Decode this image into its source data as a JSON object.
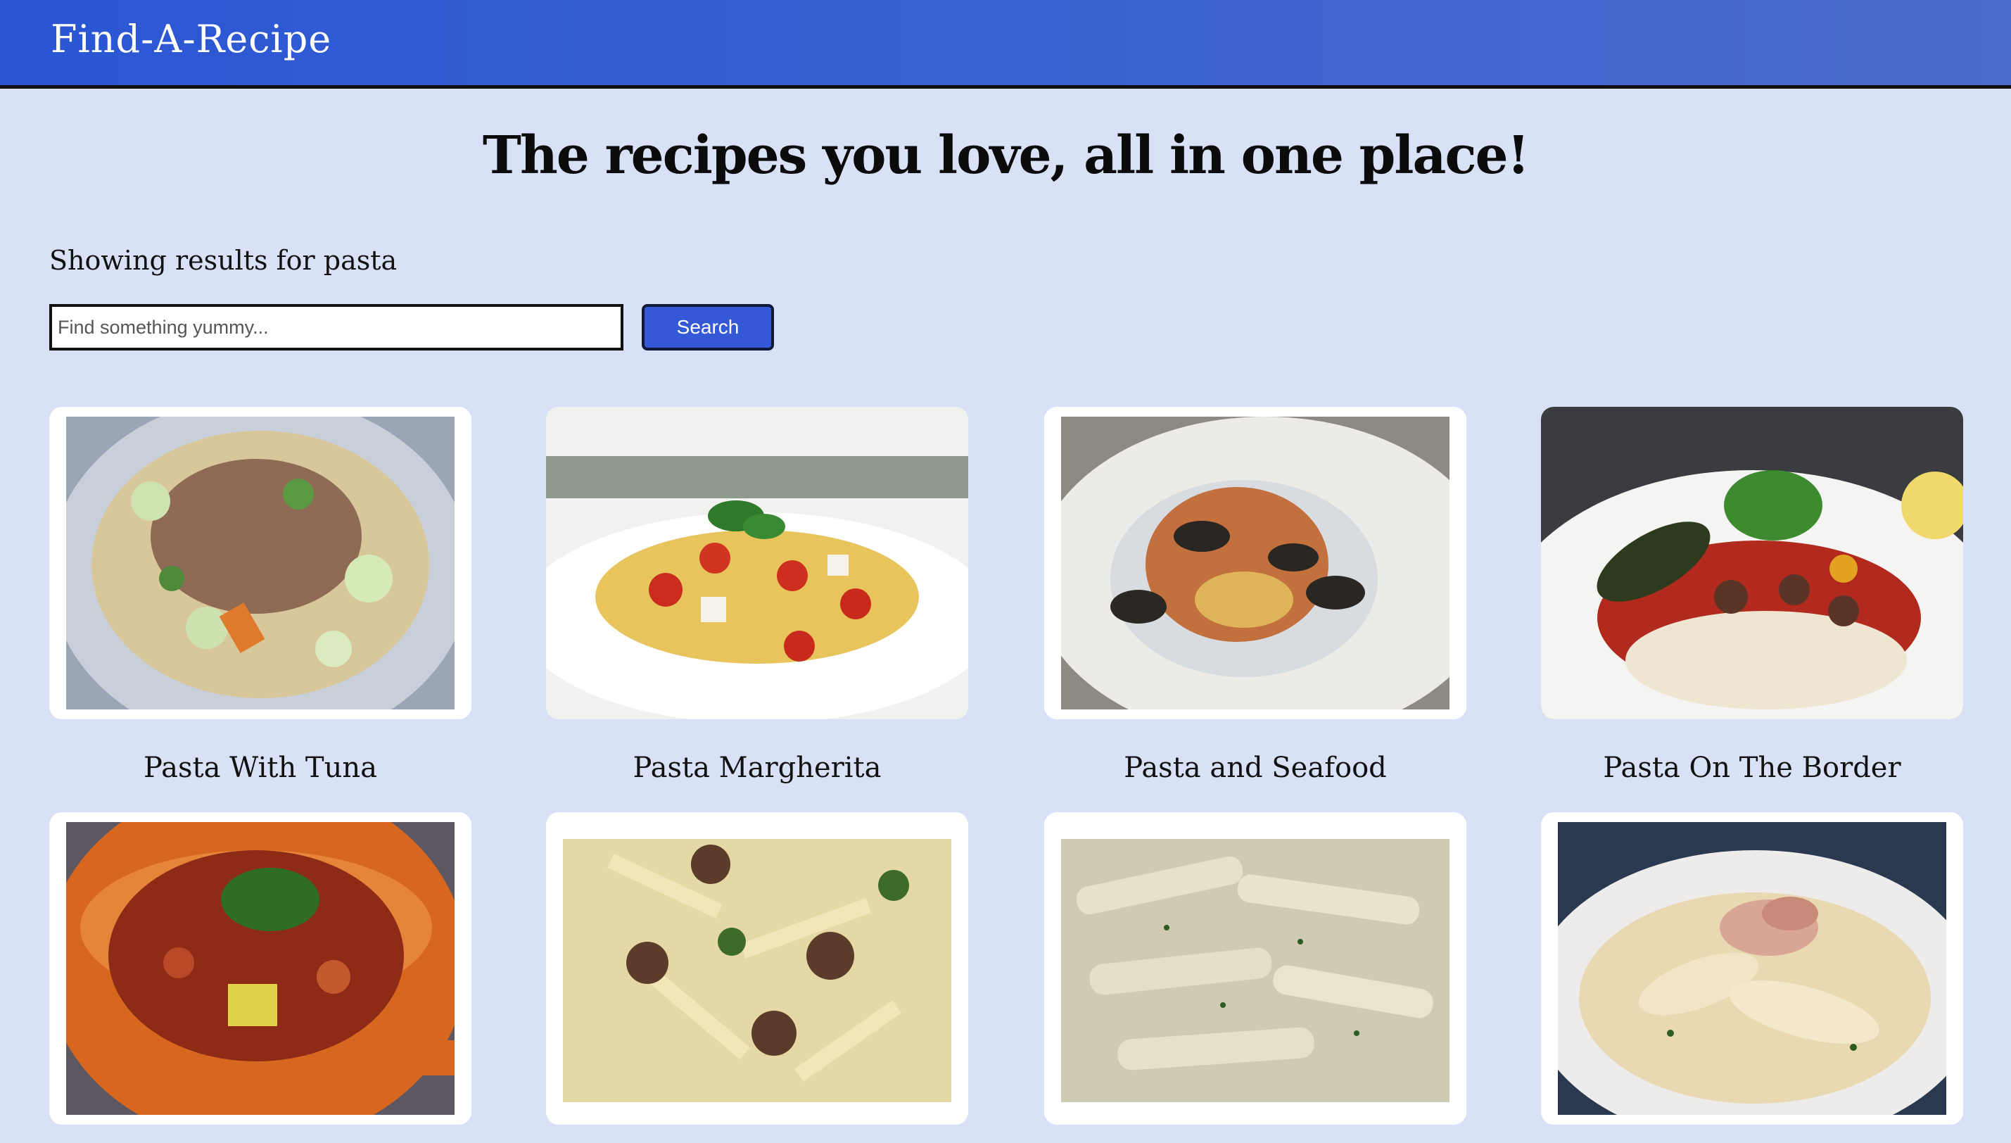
{
  "header": {
    "brand": "Find-A-Recipe"
  },
  "hero": {
    "title": "The recipes you love, all in one place!"
  },
  "search": {
    "results_prefix": "Showing results for ",
    "query": "pasta",
    "placeholder": "Find something yummy...",
    "button_label": "Search"
  },
  "recipes": [
    {
      "title": "Pasta With Tuna"
    },
    {
      "title": "Pasta Margherita"
    },
    {
      "title": "Pasta and Seafood"
    },
    {
      "title": "Pasta On The Border"
    },
    {
      "title": ""
    },
    {
      "title": ""
    },
    {
      "title": ""
    },
    {
      "title": ""
    }
  ],
  "colors": {
    "background": "#d9e1f6",
    "header": "#2b56d4",
    "button": "#3558d6"
  }
}
